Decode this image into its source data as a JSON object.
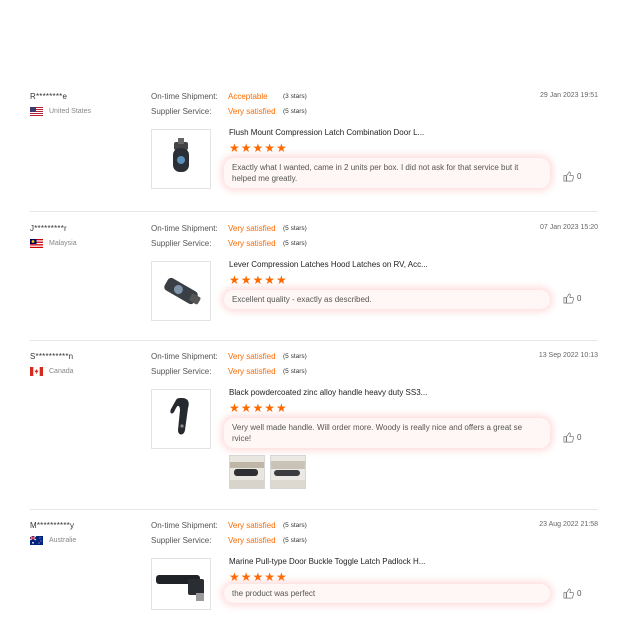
{
  "labels": {
    "shipment": "On-time Shipment:",
    "service": "Supplier Service:"
  },
  "reviews": [
    {
      "buyer": "R********e",
      "country": "United States",
      "flag": "us-flag",
      "shipment_value": "Acceptable",
      "shipment_stars": "(3 stars)",
      "service_value": "Very satisfied",
      "service_stars": "(5 stars)",
      "date": "29 Jan 2023 19:51",
      "product": "Flush Mount Compression Latch Combination Door L...",
      "rating": "★★★★★",
      "text": "Exactly what I wanted, came in 2 units per box. I did not ask for that service but it helped me greatly.",
      "likes": "0"
    },
    {
      "buyer": "J*********r",
      "country": "Malaysia",
      "flag": "malaysia-flag",
      "shipment_value": "Very satisfied",
      "shipment_stars": "(5 stars)",
      "service_value": "Very satisfied",
      "service_stars": "(5 stars)",
      "date": "07 Jan 2023 15:20",
      "product": "Lever Compression Latches Hood Latches on RV, Acc...",
      "rating": "★★★★★",
      "text": "Excellent quality - exactly as described.",
      "likes": "0"
    },
    {
      "buyer": "S**********n",
      "country": "Canada",
      "flag": "canada-flag",
      "shipment_value": "Very satisfied",
      "shipment_stars": "(5 stars)",
      "service_value": "Very satisfied",
      "service_stars": "(5 stars)",
      "date": "13 Sep 2022 10:13",
      "product": "Black powdercoated zinc alloy handle heavy duty SS3...",
      "rating": "★★★★★",
      "text": "Very well made handle. Will order more. Woody is really nice and offers a great se rvice!",
      "likes": "0"
    },
    {
      "buyer": "M**********y",
      "country": "Australie",
      "flag": "australia-flag",
      "shipment_value": "Very satisfied",
      "shipment_stars": "(5 stars)",
      "service_value": "Very satisfied",
      "service_stars": "(5 stars)",
      "date": "23 Aug 2022 21:58",
      "product": "Marine Pull-type Door Buckle Toggle Latch Padlock H...",
      "rating": "★★★★★",
      "text": "the product was perfect",
      "likes": "0"
    }
  ],
  "colors": {
    "accent": "#ff6a00",
    "bubble": "#fff7f6",
    "separator": "#e6e6e6"
  }
}
